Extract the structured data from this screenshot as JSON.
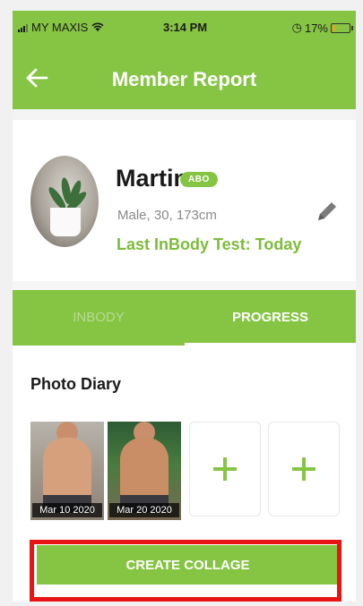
{
  "status_bar": {
    "carrier": "MY MAXIS",
    "time": "3:14 PM",
    "battery": "17%",
    "battery_level": 0.17
  },
  "header": {
    "title": "Member Report"
  },
  "profile": {
    "name": "Martin",
    "badge": "ABO",
    "details": "Male, 30, 173cm",
    "last_test": "Last InBody Test: Today"
  },
  "tabs": [
    {
      "label": "INBODY",
      "active": false
    },
    {
      "label": "PROGRESS",
      "active": true
    }
  ],
  "photo_diary": {
    "title": "Photo Diary",
    "photos": [
      {
        "date": "Mar 10 2020"
      },
      {
        "date": "Mar 20 2020"
      }
    ]
  },
  "actions": {
    "create_collage": "CREATE COLLAGE"
  },
  "colors": {
    "accent": "#86c443",
    "highlight": "#e81414"
  },
  "icons": {
    "back": "arrow-left-icon",
    "edit": "pencil-icon",
    "add": "plus-icon",
    "wifi": "wifi-icon"
  }
}
